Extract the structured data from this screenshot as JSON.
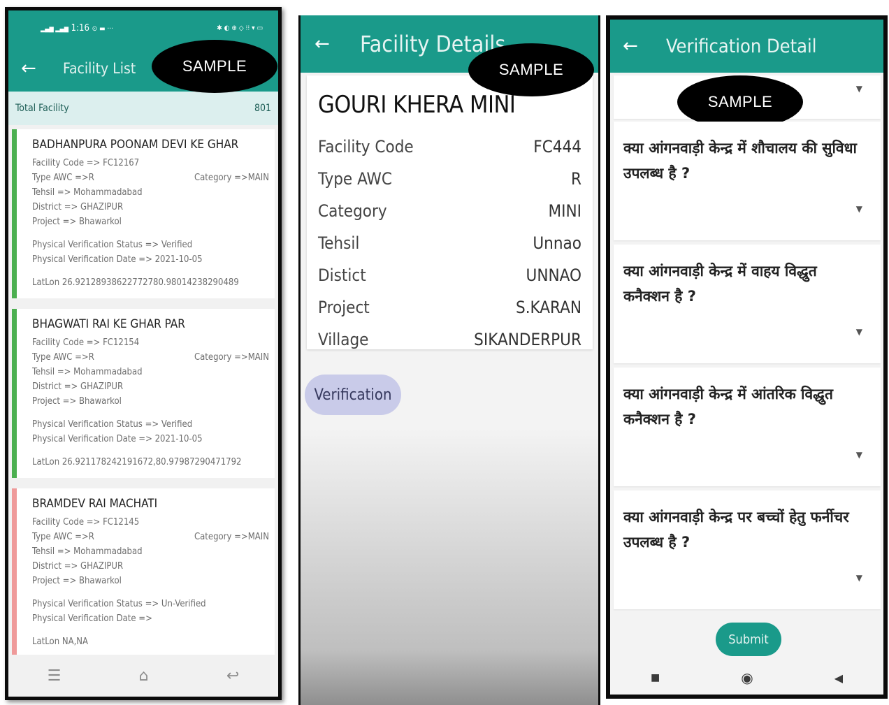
{
  "watermark": "SAMPLE",
  "phone1": {
    "status": {
      "time": "1:16",
      "left_icons": "▂▄▆ ▂▄▆",
      "extra": "⊙ ▬ ···",
      "right_icons": "✱ ◐ ⊕ ◇ ⁝⁝ ▾ ▭"
    },
    "appbar": {
      "title": "Facility List"
    },
    "total": {
      "label": "Total Facility",
      "count": "801"
    },
    "facilities": [
      {
        "name": "BADHANPURA POONAM DEVI KE GHAR",
        "code": "Facility Code => FC12167",
        "type": "Type AWC =>R",
        "category": "Category =>MAIN",
        "tehsil": "Tehsil => Mohammadabad",
        "district": "District => GHAZIPUR",
        "project": "Project => Bhawarkol",
        "status": "Physical Verification Status => Verified",
        "date": "Physical Verification Date => 2021-10-05",
        "latlon": "LatLon 26.92128938622772780.98014238290489",
        "verified": true
      },
      {
        "name": "BHAGWATI RAI KE GHAR PAR",
        "code": "Facility Code => FC12154",
        "type": "Type AWC =>R",
        "category": "Category =>MAIN",
        "tehsil": "Tehsil => Mohammadabad",
        "district": "District => GHAZIPUR",
        "project": "Project => Bhawarkol",
        "status": "Physical Verification Status => Verified",
        "date": "Physical Verification Date => 2021-10-05",
        "latlon": "LatLon 26.921178242191672,80.97987290471792",
        "verified": true
      },
      {
        "name": "BRAMDEV RAI MACHATI",
        "code": "Facility Code => FC12145",
        "type": "Type AWC =>R",
        "category": "Category =>MAIN",
        "tehsil": "Tehsil => Mohammadabad",
        "district": "District => GHAZIPUR",
        "project": "Project => Bhawarkol",
        "status": "Physical Verification Status => Un-Verified",
        "date": "Physical Verification Date =>",
        "latlon": "LatLon NA,NA",
        "verified": false
      }
    ],
    "nav": {
      "menu": "☰",
      "home": "⌂",
      "back": "↩"
    }
  },
  "phone2": {
    "appbar": {
      "title": "Facility Details"
    },
    "facility_name": "GOURI KHERA MINI",
    "rows": [
      {
        "label": "Facility Code",
        "value": "FC444"
      },
      {
        "label": "Type AWC",
        "value": "R"
      },
      {
        "label": "Category",
        "value": "MINI"
      },
      {
        "label": "Tehsil",
        "value": "Unnao"
      },
      {
        "label": "Distict",
        "value": "UNNAO"
      },
      {
        "label": "Project",
        "value": "S.KARAN"
      },
      {
        "label": "Village",
        "value": "SIKANDERPUR"
      }
    ],
    "verification_button": "Verification"
  },
  "phone3": {
    "appbar": {
      "title": "Verification Detail"
    },
    "questions": [
      {
        "line1": "क्या आंगनवाड़ी केन्द्र में शौचालय की सुविधा",
        "line2": "उपलब्ध है ?"
      },
      {
        "line1": "क्या आंगनवाड़ी केन्द्र में वाहय विद्धुत",
        "line2": "कनैक्शन है ?"
      },
      {
        "line1": "क्या आंगनवाड़ी केन्द्र में आंतरिक विद्धुत",
        "line2": "कनैक्शन है ?"
      },
      {
        "line1": "क्या आंगनवाड़ी केन्द्र पर बच्चों हेतु फर्नीचर",
        "line2": "उपलब्ध है ?"
      }
    ],
    "submit_label": "Submit",
    "nav": {
      "recents": "■",
      "home": "◉",
      "back": "◀"
    }
  },
  "icons": {
    "back": "←",
    "dropdown": "▼"
  },
  "colors": {
    "primary": "#1a9a8a",
    "verified": "#4caf50",
    "unverified": "#ef9a9a",
    "verification_button": "#c9cbe9"
  }
}
